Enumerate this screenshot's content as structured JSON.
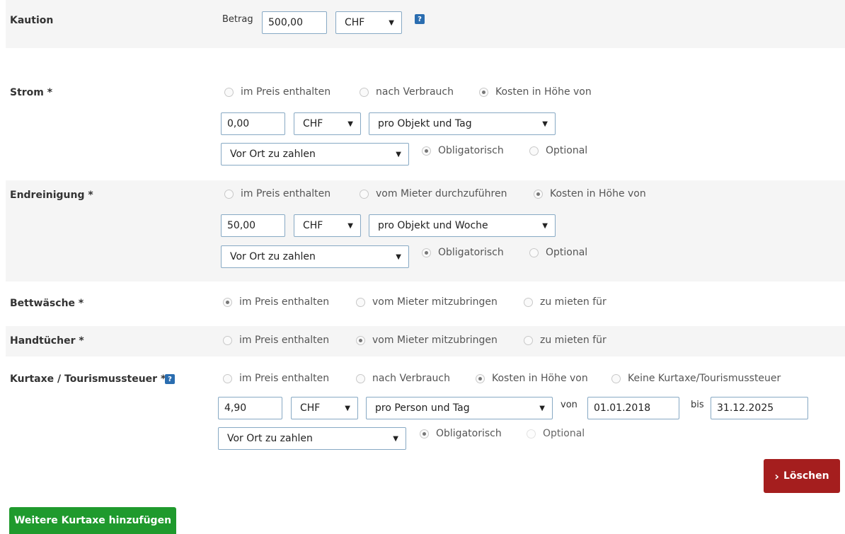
{
  "kaution": {
    "label": "Kaution",
    "amount_label": "Betrag",
    "amount": "500,00",
    "currency": "CHF"
  },
  "strom": {
    "label": "Strom *",
    "options": [
      "im Preis enthalten",
      "nach Verbrauch",
      "Kosten in Höhe von"
    ],
    "selected": 2,
    "amount": "0,00",
    "currency": "CHF",
    "unit": "pro Objekt und Tag",
    "payment": "Vor Ort zu zahlen",
    "obligation_options": [
      "Obligatorisch",
      "Optional"
    ],
    "obligation_selected": 0
  },
  "endreinigung": {
    "label": "Endreinigung *",
    "options": [
      "im Preis enthalten",
      "vom Mieter durchzuführen",
      "Kosten in Höhe von"
    ],
    "selected": 2,
    "amount": "50,00",
    "currency": "CHF",
    "unit": "pro Objekt und Woche",
    "payment": "Vor Ort zu zahlen",
    "obligation_options": [
      "Obligatorisch",
      "Optional"
    ],
    "obligation_selected": 0
  },
  "bettwaesche": {
    "label": "Bettwäsche *",
    "options": [
      "im Preis enthalten",
      "vom Mieter mitzubringen",
      "zu mieten für"
    ],
    "selected": 0
  },
  "handtuecher": {
    "label": "Handtücher *",
    "options": [
      "im Preis enthalten",
      "vom Mieter mitzubringen",
      "zu mieten für"
    ],
    "selected": 1
  },
  "kurtaxe": {
    "label": "Kurtaxe / Tourismussteuer *",
    "options": [
      "im Preis enthalten",
      "nach Verbrauch",
      "Kosten in Höhe von",
      "Keine Kurtaxe/Tourismussteuer"
    ],
    "selected": 2,
    "amount": "4,90",
    "currency": "CHF",
    "unit": "pro Person und Tag",
    "from_label": "von",
    "from_date": "01.01.2018",
    "to_label": "bis",
    "to_date": "31.12.2025",
    "payment": "Vor Ort zu zahlen",
    "obligation_options": [
      "Obligatorisch",
      "Optional"
    ],
    "obligation_selected": 0
  },
  "actions": {
    "delete_label": "Löschen",
    "add_label": "Weitere Kurtaxe hinzufügen"
  },
  "icons": {
    "help": "?",
    "caret": "▼",
    "delete_chevron": "›"
  },
  "colors": {
    "band": "#f5f5f5",
    "delete_button": "#a51e1e",
    "add_button": "#1f9a2d",
    "help_icon": "#2a6db0"
  }
}
